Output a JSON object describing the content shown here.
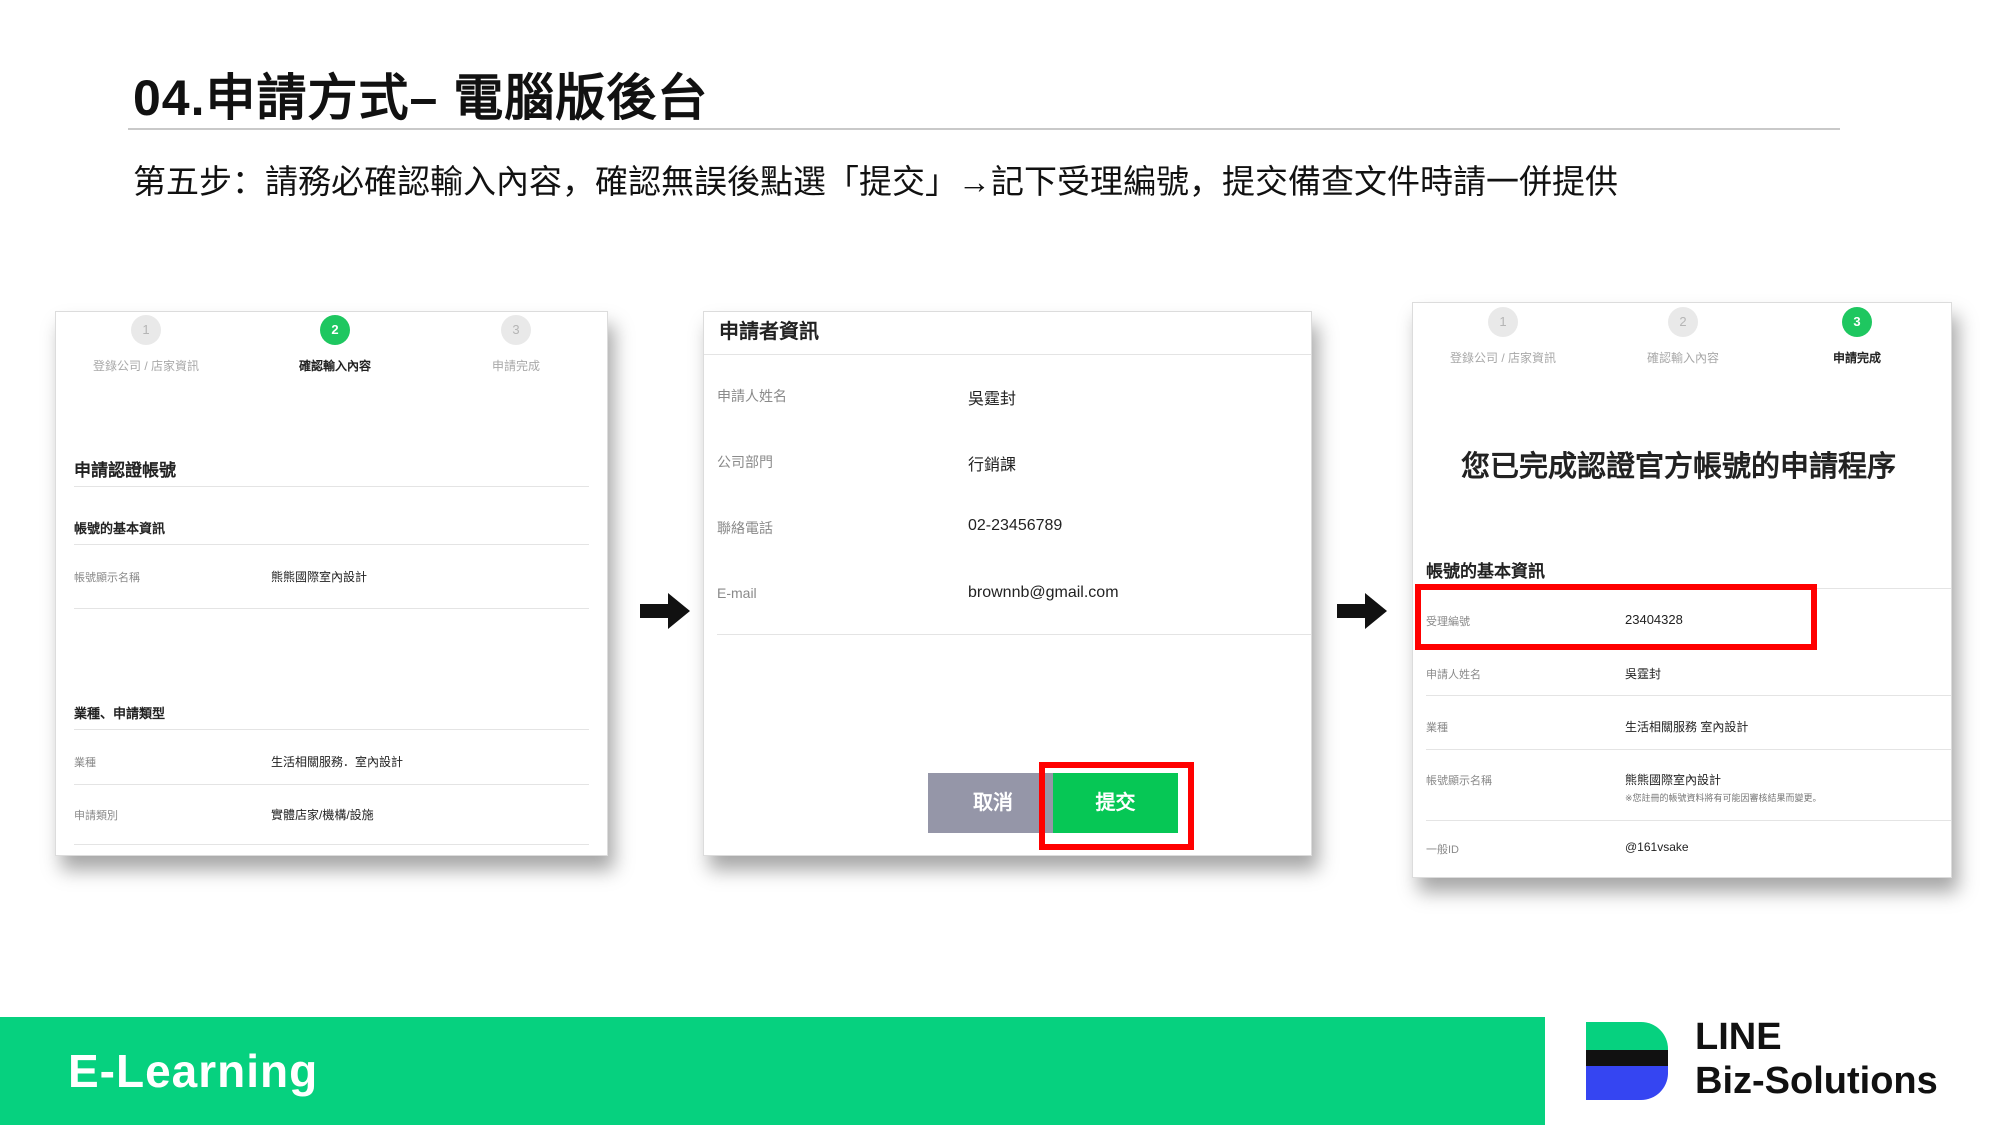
{
  "header": {
    "title": "04.申請方式– 電腦版後台",
    "subtitle": "第五步：請務必確認輸入內容，確認無誤後點選「提交」→記下受理編號，提交備查文件時請一併提供"
  },
  "panel1": {
    "steps": [
      {
        "num": "1",
        "label": "登錄公司 / 店家資訊"
      },
      {
        "num": "2",
        "label": "確認輸入內容"
      },
      {
        "num": "3",
        "label": "申請完成"
      }
    ],
    "section_title": "申請認證帳號",
    "basic_title": "帳號的基本資訊",
    "display_name_key": "帳號顯示名稱",
    "display_name_value": "熊熊國際室內設計",
    "industry_title": "業種、申請類型",
    "industry_key": "業種",
    "industry_value": "生活相關服務．室內設計",
    "type_key": "申請類別",
    "type_value": "實體店家/機構/設施"
  },
  "panel2": {
    "title": "申請者資訊",
    "rows": [
      {
        "key": "申請人姓名",
        "value": "吳霆封"
      },
      {
        "key": "公司部門",
        "value": "行銷課"
      },
      {
        "key": "聯絡電話",
        "value": "02-23456789"
      },
      {
        "key": "E-mail",
        "value": "brownnb@gmail.com"
      }
    ],
    "cancel_label": "取消",
    "submit_label": "提交"
  },
  "panel3": {
    "steps": [
      {
        "num": "1",
        "label": "登錄公司 / 店家資訊"
      },
      {
        "num": "2",
        "label": "確認輸入內容"
      },
      {
        "num": "3",
        "label": "申請完成"
      }
    ],
    "complete_title": "您已完成認證官方帳號的申請程序",
    "basic_title": "帳號的基本資訊",
    "rows": [
      {
        "key": "受理編號",
        "value": "23404328"
      },
      {
        "key": "申請人姓名",
        "value": "吳霆封"
      },
      {
        "key": "業種",
        "value": "生活相關服務 室內設計"
      },
      {
        "key": "帳號顯示名稱",
        "value": "熊熊國際室內設計"
      },
      {
        "key": "一般ID",
        "value": "@161vsake"
      }
    ],
    "note": "※您註冊的帳號資料將有可能因審核結果而變更。"
  },
  "footer": {
    "label": "E-Learning",
    "brand_line1": "LINE",
    "brand_line2": "Biz-Solutions"
  },
  "colors": {
    "accent_green": "#06d17f",
    "step_green": "#1ec760",
    "highlight_red": "#ff0000",
    "cancel_gray": "#9596a8",
    "logo_blue": "#3545f2"
  },
  "icons": [
    "right-arrow-icon",
    "line-biz-logo-icon"
  ]
}
